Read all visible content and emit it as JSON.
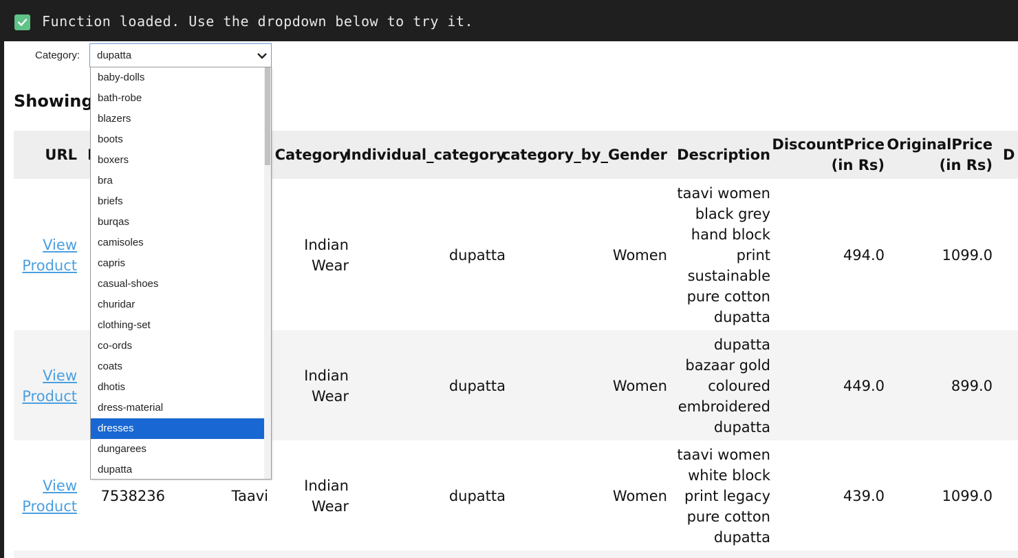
{
  "console": {
    "message": "Function loaded. Use the dropdown below to try it."
  },
  "filter": {
    "label": "Category:",
    "selected": "dupatta"
  },
  "heading": "Showing",
  "dropdown": {
    "highlighted": "dresses",
    "options": [
      "baby-dolls",
      "bath-robe",
      "blazers",
      "boots",
      "boxers",
      "bra",
      "briefs",
      "burqas",
      "camisoles",
      "capris",
      "casual-shoes",
      "churidar",
      "clothing-set",
      "co-ords",
      "coats",
      "dhotis",
      "dress-material",
      "dresses",
      "dungarees",
      "dupatta"
    ]
  },
  "table": {
    "headers": {
      "url": "URL",
      "id_partial": "I",
      "category": "Category",
      "individual_category": "Individual_category",
      "category_by_gender": "category_by_Gender",
      "description": "Description",
      "discount_price": [
        "DiscountPrice",
        "(in Rs)"
      ],
      "original_price": [
        "OriginalPrice",
        "(in Rs)"
      ],
      "next_partial": "D"
    },
    "rows": [
      {
        "url": [
          "View",
          "Product"
        ],
        "product_id": "",
        "brand": "",
        "category": [
          "Indian",
          "Wear"
        ],
        "individual_category": "dupatta",
        "gender": "Women",
        "description": [
          "taavi women",
          "black grey",
          "hand block",
          "print",
          "sustainable",
          "pure cotton",
          "dupatta"
        ],
        "discount_price": "494.0",
        "original_price": "1099.0"
      },
      {
        "url": [
          "View",
          "Product"
        ],
        "product_id": "",
        "brand": "",
        "category": [
          "Indian",
          "Wear"
        ],
        "individual_category": "dupatta",
        "gender": "Women",
        "description": [
          "dupatta",
          "bazaar gold",
          "coloured",
          "embroidered",
          "dupatta"
        ],
        "discount_price": "449.0",
        "original_price": "899.0"
      },
      {
        "url": [
          "View",
          "Product"
        ],
        "product_id": "7538236",
        "brand": "Taavi",
        "category": [
          "Indian",
          "Wear"
        ],
        "individual_category": "dupatta",
        "gender": "Women",
        "description": [
          "taavi women",
          "white block",
          "print legacy",
          "pure cotton",
          "dupatta"
        ],
        "discount_price": "439.0",
        "original_price": "1099.0"
      }
    ]
  },
  "colors": {
    "accent": "#1967d2",
    "link": "#4a9fe0",
    "check": "#5fc286",
    "console_bg": "#1f1f1f"
  }
}
